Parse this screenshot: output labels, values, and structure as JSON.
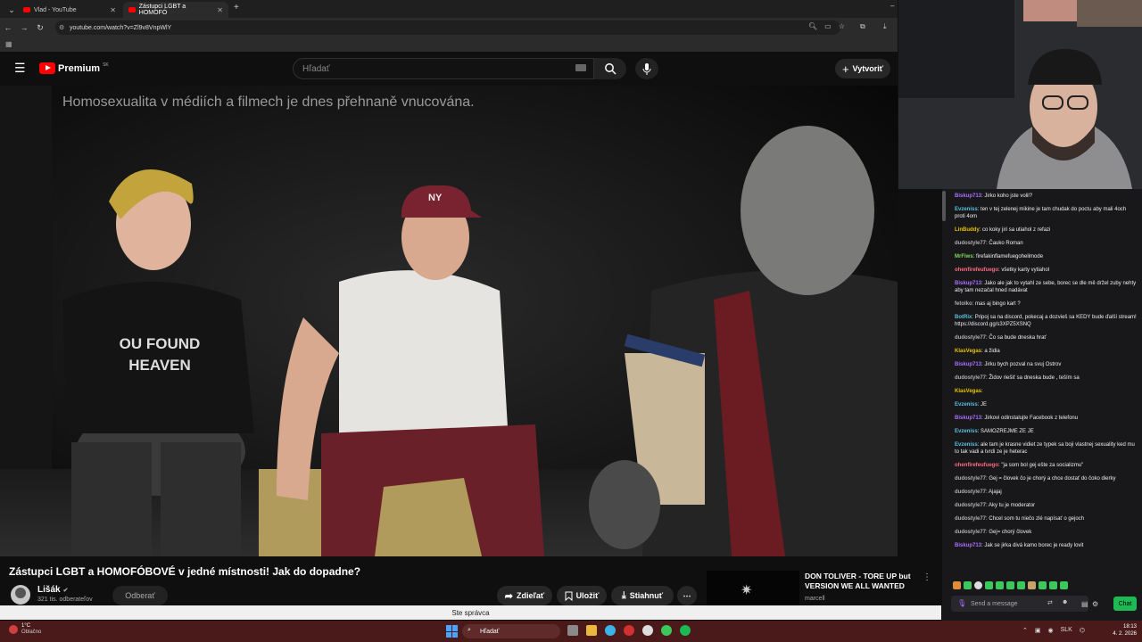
{
  "browser": {
    "tabs": [
      {
        "label": "Vlad - YouTube"
      },
      {
        "label": "Zástupci LGBT a HOMOFÓ"
      }
    ],
    "url": "youtube.com/watch?v=Zl9v8VnpWlY"
  },
  "youtube": {
    "logo_text": "Premium",
    "region": "SK",
    "search_placeholder": "Hľadať",
    "create_label": "Vytvoriť"
  },
  "video": {
    "caption": "Homosexualita v médiích a filmech je dnes přehnaně vnucována.",
    "shirt_text_1": "OU FOUND",
    "shirt_text_2": "HEAVEN",
    "cap_logo": "NY",
    "title": "Zástupci LGBT a HOMOFÓBOVÉ v jedné místnosti! Jak do dopadne?",
    "channel_name": "Lišák",
    "subscribers": "321 tis. odberateľov",
    "subscribe_label": "Odberať",
    "share_label": "Zdieľať",
    "save_label": "Uložiť",
    "download_label": "Stiahnuť",
    "more_label": "⋯"
  },
  "recommended": {
    "title": "DON TOLIVER - TORE UP but VERSION WE ALL WANTED",
    "channel": "marcell"
  },
  "statusbar": {
    "text": "Ste správca"
  },
  "taskbar": {
    "weather_temp": "1°C",
    "weather_desc": "Oblačno",
    "search_placeholder": "Hľadať",
    "lang": "SLK",
    "time": "18:13",
    "date": "4. 2. 2026"
  },
  "chat": {
    "messages": [
      {
        "user": "Biskup713",
        "color": "#a970ff",
        "text": "Jirko koho jste volil?"
      },
      {
        "user": "Evzeniss",
        "color": "#5bc0de",
        "text": "ten v tej zelenej mikine je tam chudak do poctu aby mali 4och proti 4om"
      },
      {
        "user": "LinBuddy",
        "color": "#e6c300",
        "text": "co koky jiri sa utiahol z refazi"
      },
      {
        "user": "dudostyle77",
        "color": "#b0b0b0",
        "text": "Čauko Roman"
      },
      {
        "user": "MrFiws",
        "color": "#7ed957",
        "text": "firefakinflamefuegohelimode"
      },
      {
        "user": "ohenfirefeufuego",
        "color": "#ff6b81",
        "text": "všetky karty vytiahol"
      },
      {
        "user": "Biskup713",
        "color": "#a970ff",
        "text": "Jako ale jak to vytahl ze sebe, borec se dle mě držel zuby nehty aby tam nezačal hned nadávat"
      },
      {
        "user": "fetolko",
        "color": "#b0b0b0",
        "text": "mas aj bingo kart ?"
      },
      {
        "user": "BotRix",
        "color": "#5bc0de",
        "text": "Pripoj sa na discord, pokecaj a dozvieš sa KEDY bude ďalší stream! https://discord.gg/s3XPZ5XSNQ"
      },
      {
        "user": "dudostyle77",
        "color": "#b0b0b0",
        "text": "Čo sa bude dneska hrať"
      },
      {
        "user": "KlasVegas",
        "color": "#e6c300",
        "text": "a židia"
      },
      {
        "user": "Biskup713",
        "color": "#a970ff",
        "text": "Jirku bych pozval na svuj Ostrov"
      },
      {
        "user": "dudostyle77",
        "color": "#b0b0b0",
        "text": "Židov riešiť sa dneska bude , teším sa"
      },
      {
        "user": "KlasVegas",
        "color": "#e6c300",
        "text": ""
      },
      {
        "user": "Evzeniss",
        "color": "#5bc0de",
        "text": "JE"
      },
      {
        "user": "Biskup713",
        "color": "#a970ff",
        "text": "Jirkovi odinstalujte Facebook z telefonu"
      },
      {
        "user": "Evzeniss",
        "color": "#5bc0de",
        "text": "SAMOZREJME ZE JE"
      },
      {
        "user": "Evzeniss",
        "color": "#5bc0de",
        "text": "ale tam je krasne vidiet ze typek sa boji vlastnej sexuality ked mu to tak vadi a tvrdi ze je heterac"
      },
      {
        "user": "ohenfirefeufuego",
        "color": "#ff6b81",
        "text": "\"ja som bol gej ešte za socializmu\""
      },
      {
        "user": "dudostyle77",
        "color": "#b0b0b0",
        "text": "Gej = človek čo je chorý a chce dostať do čoko dierky"
      },
      {
        "user": "dudostyle77",
        "color": "#b0b0b0",
        "text": "Ajajaj"
      },
      {
        "user": "dudostyle77",
        "color": "#b0b0b0",
        "text": "Aky tu je moderator"
      },
      {
        "user": "dudostyle77",
        "color": "#b0b0b0",
        "text": "Chcel som tu niečo zlé napísať o gejoch"
      },
      {
        "user": "dudostyle77",
        "color": "#b0b0b0",
        "text": "Gej= chorý človek"
      },
      {
        "user": "Biskup713",
        "color": "#a970ff",
        "text": "Jak se jirka divá kamo borec je ready lovit"
      }
    ],
    "input_placeholder": "Send a message",
    "send_label": "Chat"
  },
  "colors": {
    "accent": "#ff0000",
    "chat_send": "#1db954",
    "taskbar": "#4a1a1a"
  }
}
